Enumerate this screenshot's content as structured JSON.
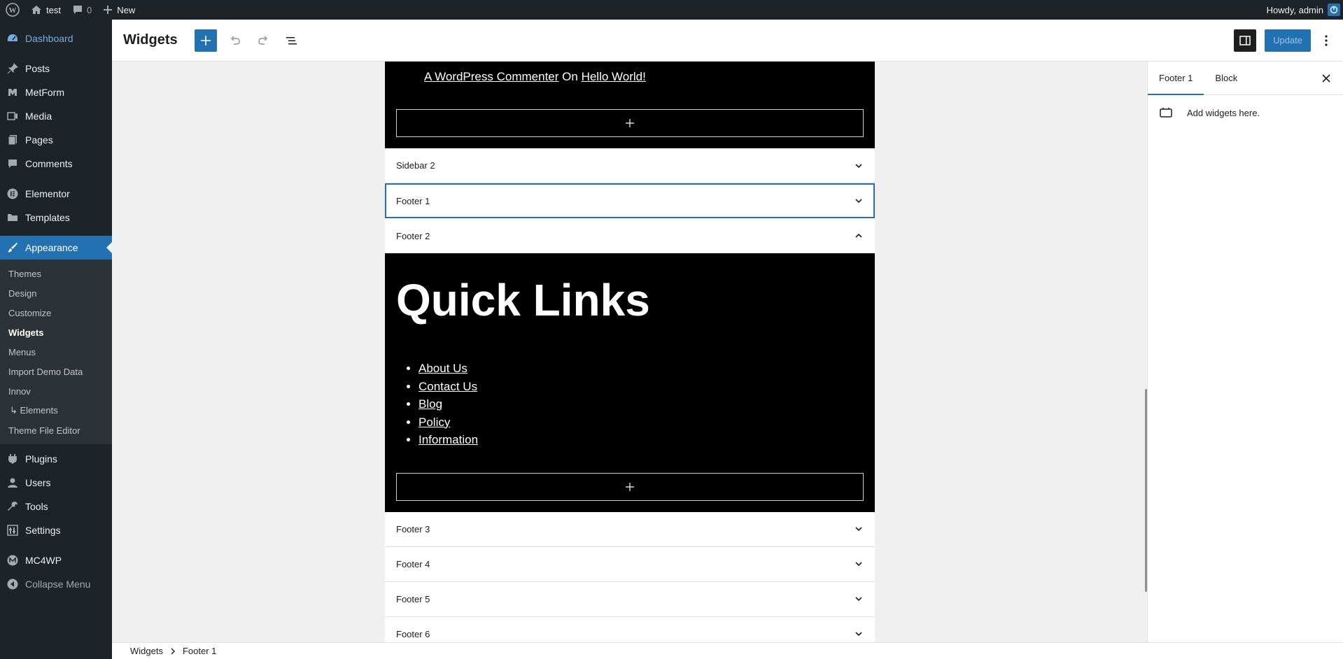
{
  "adminbar": {
    "site_name": "test",
    "comments_count": "0",
    "new_label": "New",
    "howdy": "Howdy, admin"
  },
  "menu": {
    "items_top": [
      {
        "label": "Dashboard",
        "icon": "dashboard-icon"
      }
    ],
    "items_content": [
      {
        "label": "Posts",
        "icon": "pin-icon"
      },
      {
        "label": "MetForm",
        "icon": "form-icon"
      },
      {
        "label": "Media",
        "icon": "media-icon"
      },
      {
        "label": "Pages",
        "icon": "pages-icon"
      },
      {
        "label": "Comments",
        "icon": "comment-icon"
      }
    ],
    "items_builder": [
      {
        "label": "Elementor",
        "icon": "elementor-icon"
      },
      {
        "label": "Templates",
        "icon": "folder-icon"
      }
    ],
    "appearance": {
      "label": "Appearance",
      "icon": "brush-icon"
    },
    "submenu": [
      "Themes",
      "Design",
      "Customize",
      "Widgets",
      "Menus",
      "Import Demo Data",
      "Innov",
      "↳ Elements",
      "Theme File Editor"
    ],
    "items_tools": [
      {
        "label": "Plugins",
        "icon": "plugin-icon"
      },
      {
        "label": "Users",
        "icon": "users-icon"
      },
      {
        "label": "Tools",
        "icon": "wrench-icon"
      },
      {
        "label": "Settings",
        "icon": "settings-icon"
      }
    ],
    "mc4wp": "MC4WP",
    "collapse": "Collapse Menu"
  },
  "header": {
    "title": "Widgets",
    "update_label": "Update"
  },
  "canvas": {
    "recent_comment": {
      "author": "A WordPress Commenter",
      "on": "On",
      "post": "Hello World!"
    },
    "areas_before": [
      "Sidebar 2",
      "Footer 1",
      "Footer 2"
    ],
    "quick_links": {
      "title": "Quick Links",
      "links": [
        "About Us",
        "Contact Us",
        "Blog",
        "Policy",
        "Information"
      ]
    },
    "areas_after": [
      "Footer 3",
      "Footer 4",
      "Footer 5",
      "Footer 6"
    ]
  },
  "sidebar": {
    "tab_area": "Footer 1",
    "tab_block": "Block",
    "empty_text": "Add widgets here."
  },
  "breadcrumb": {
    "root": "Widgets",
    "current": "Footer 1"
  }
}
